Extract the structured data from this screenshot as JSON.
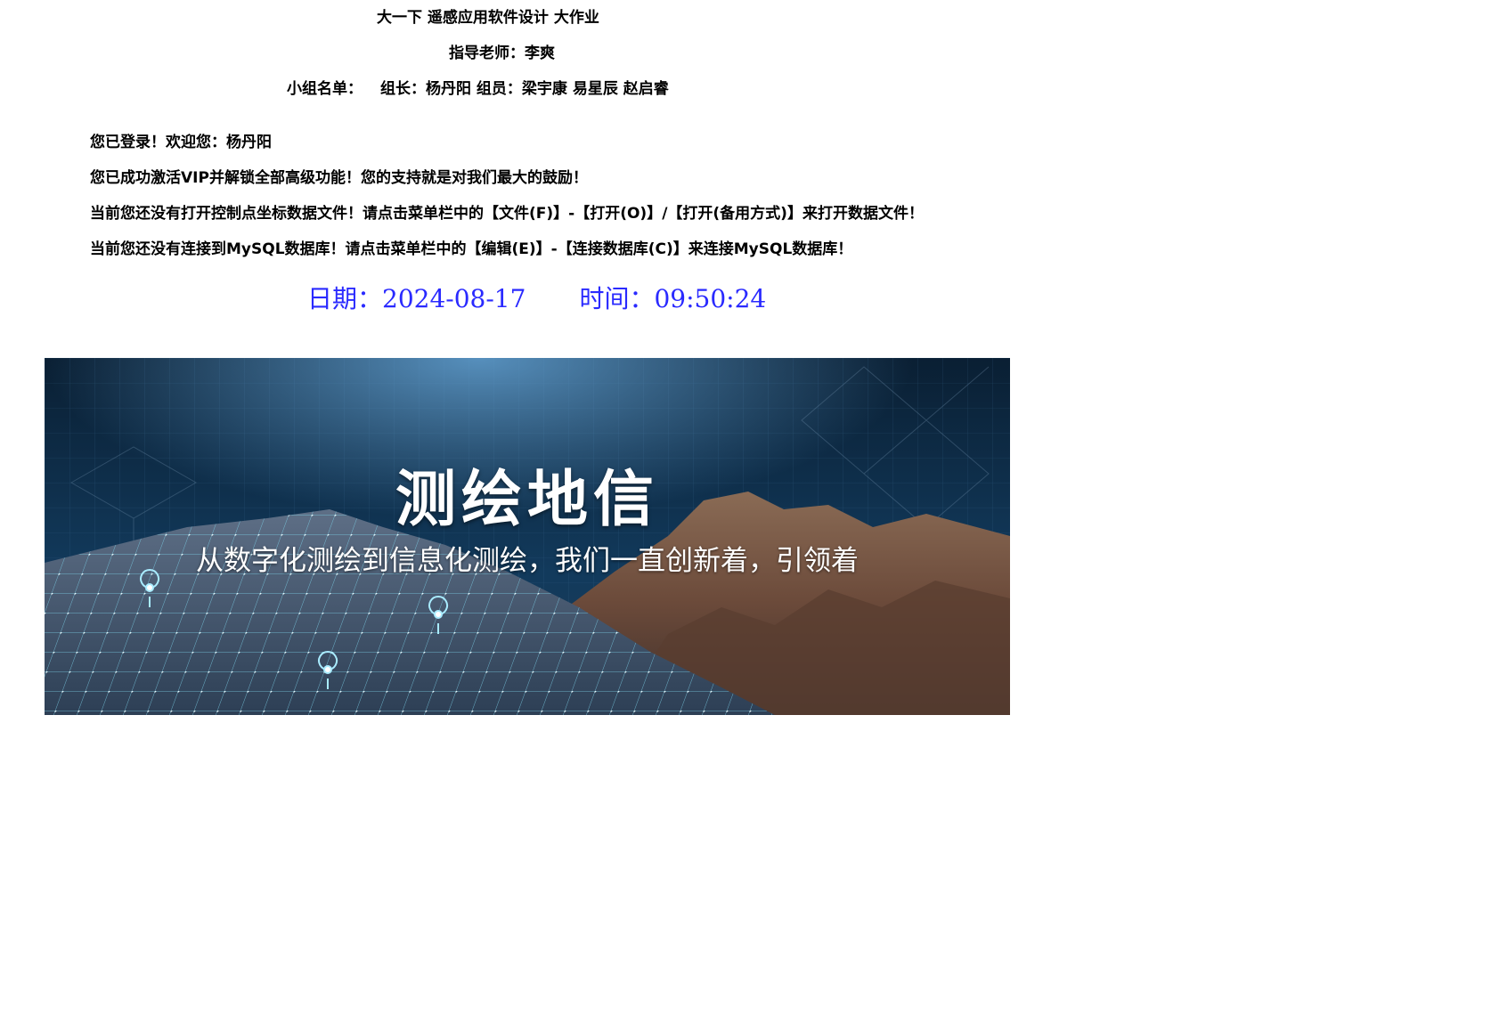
{
  "header": {
    "title": "大一下 遥感应用软件设计 大作业",
    "advisor": "指导老师：李爽",
    "group_label": "小组名单：",
    "group_members": "组长：杨丹阳  组员：梁宇康 易星辰 赵启睿"
  },
  "status": {
    "login": "您已登录！欢迎您：杨丹阳",
    "vip": "您已成功激活VIP并解锁全部高级功能！您的支持就是对我们最大的鼓励！",
    "file_hint": "当前您还没有打开控制点坐标数据文件！请点击菜单栏中的【文件(F)】-【打开(O)】/【打开(备用方式)】来打开数据文件！",
    "db_hint": "当前您还没有连接到MySQL数据库！请点击菜单栏中的【编辑(E)】-【连接数据库(C)】来连接MySQL数据库！"
  },
  "datetime": {
    "date": "日期：2024-08-17",
    "time": "时间：09:50:24"
  },
  "banner": {
    "title": "测绘地信",
    "subtitle": "从数字化测绘到信息化测绘，我们一直创新着，引领着"
  },
  "colors": {
    "datetime": "#2a2aff",
    "banner_bg": "#0e2a45"
  }
}
